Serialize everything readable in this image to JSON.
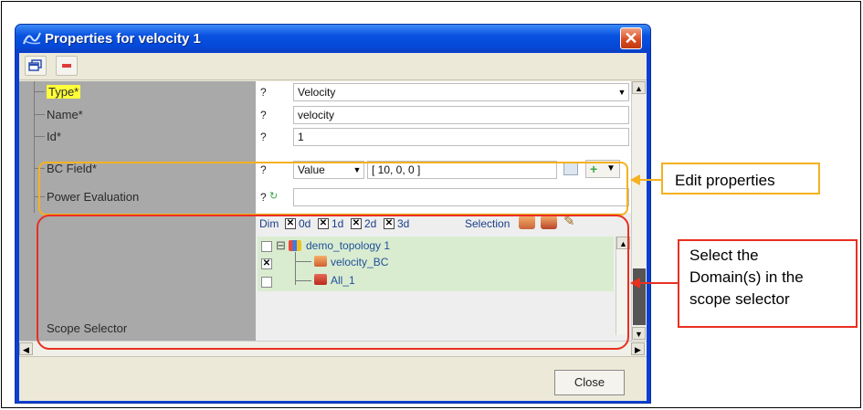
{
  "window": {
    "title": "Properties for velocity 1",
    "close_glyph": "✕"
  },
  "toolbar": {
    "icons": [
      "windows-icon",
      "minus-icon"
    ]
  },
  "properties": [
    {
      "label": "Type*",
      "q": "?",
      "value": "Velocity"
    },
    {
      "label": "Name*",
      "q": "?",
      "value": "velocity"
    },
    {
      "label": "Id*",
      "q": "?",
      "value": "1"
    },
    {
      "label": "BC Field*",
      "q": "?",
      "mode": "Value",
      "value": "[ 10, 0, 0 ]"
    },
    {
      "label": "Power Evaluation",
      "q": "?",
      "value": ""
    },
    {
      "label": "Scope Selector"
    }
  ],
  "scope": {
    "dim_label": "Dim",
    "dims": [
      {
        "label": "0d",
        "checked": true
      },
      {
        "label": "1d",
        "checked": true
      },
      {
        "label": "2d",
        "checked": true
      },
      {
        "label": "3d",
        "checked": true
      }
    ],
    "selection_label": "Selection",
    "tree": [
      {
        "label": "demo_topology 1",
        "checked": false,
        "expander": "⊟"
      },
      {
        "label": "velocity_BC",
        "checked": true
      },
      {
        "label": "All_1",
        "checked": false
      }
    ]
  },
  "footer": {
    "close_label": "Close"
  },
  "annotations": {
    "edit": "Edit properties",
    "select": "Select the\nDomain(s) in the\nscope selector"
  },
  "colors": {
    "type_highlight": "#ffff3a",
    "orange": "#f5b120",
    "red": "#e83020"
  }
}
